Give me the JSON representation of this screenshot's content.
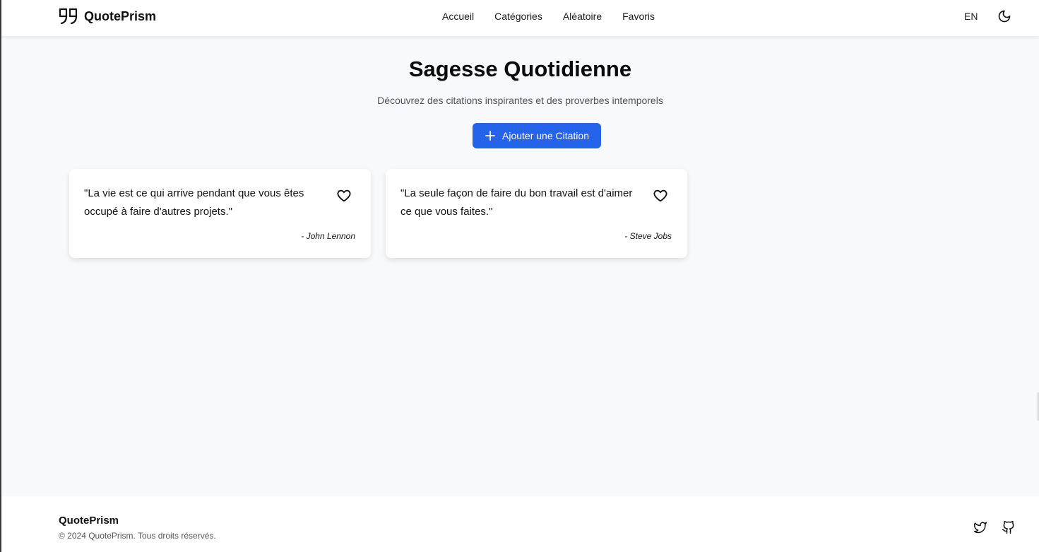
{
  "header": {
    "brand": "QuotePrism",
    "nav": [
      "Accueil",
      "Catégories",
      "Aléatoire",
      "Favoris"
    ],
    "lang": "EN",
    "theme_icon": "moon-icon"
  },
  "hero": {
    "title": "Sagesse Quotidienne",
    "subtitle": "Découvrez des citations inspirantes et des proverbes intemporels",
    "add_button": "Ajouter une Citation"
  },
  "quotes": [
    {
      "text": "\"La vie est ce qui arrive pendant que vous êtes occupé à faire d'autres projets.\"",
      "author": "- John Lennon",
      "favorite": false
    },
    {
      "text": "\"La seule façon de faire du bon travail est d'aimer ce que vous faites.\"",
      "author": "- Steve Jobs",
      "favorite": false
    }
  ],
  "footer": {
    "brand": "QuotePrism",
    "copyright": "© 2024 QuotePrism. Tous droits réservés.",
    "social_icons": [
      "twitter-icon",
      "github-icon"
    ]
  },
  "colors": {
    "accent": "#2563eb",
    "background": "#f8f9fb",
    "surface": "#ffffff"
  }
}
